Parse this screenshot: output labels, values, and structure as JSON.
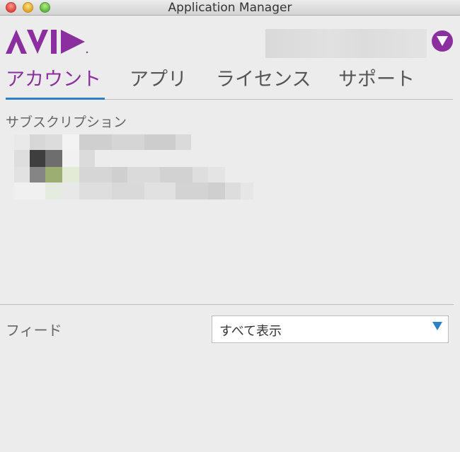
{
  "window": {
    "title": "Application Manager"
  },
  "brand": {
    "logo_text": "AVID",
    "accent_color": "#8a2f9d",
    "tab_underline_color": "#2e7fc4"
  },
  "header": {
    "menu_icon": "triangle-down-icon"
  },
  "tabs": [
    {
      "label": "アカウント",
      "active": true
    },
    {
      "label": "アプリ",
      "active": false
    },
    {
      "label": "ライセンス",
      "active": false
    },
    {
      "label": "サポート",
      "active": false
    }
  ],
  "subscription": {
    "label": "サブスクリプション"
  },
  "feed": {
    "label": "フィード",
    "selected": "すべて表示"
  }
}
